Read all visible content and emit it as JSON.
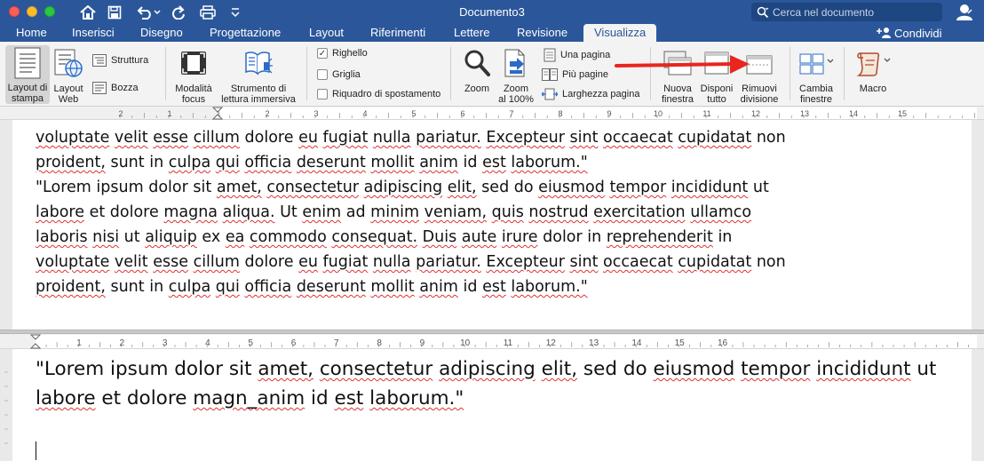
{
  "window": {
    "title": "Documento3",
    "search_placeholder": "Cerca nel documento",
    "share_label": "Condividi"
  },
  "tabs": [
    "Home",
    "Inserisci",
    "Disegno",
    "Progettazione",
    "Layout",
    "Riferimenti",
    "Lettere",
    "Revisione",
    "Visualizza"
  ],
  "active_tab": "Visualizza",
  "ribbon": {
    "layout_stampa": [
      "Layout di",
      "stampa"
    ],
    "layout_web": [
      "Layout",
      "Web"
    ],
    "struttura": "Struttura",
    "bozza": "Bozza",
    "modalita_focus": [
      "Modalità",
      "focus"
    ],
    "strumento_lettura": [
      "Strumento di",
      "lettura immersiva"
    ],
    "righello": "Righello",
    "griglia": "Griglia",
    "riquadro": "Riquadro di spostamento",
    "zoom": "Zoom",
    "zoom100": [
      "Zoom",
      "al 100%"
    ],
    "una_pagina": "Una pagina",
    "piu_pagine": "Più pagine",
    "larghezza_pagina": "Larghezza pagina",
    "nuova_finestra": [
      "Nuova",
      "finestra"
    ],
    "disponi_tutto": [
      "Disponi",
      "tutto"
    ],
    "rimuovi_divisione": [
      "Rimuovi",
      "divisione"
    ],
    "cambia_finestre": [
      "Cambia",
      "finestre"
    ],
    "macro": "Macro",
    "righello_checked": true,
    "griglia_checked": false,
    "riquadro_checked": false
  },
  "ruler_top_numbers": [
    "2",
    "1",
    "1",
    "2",
    "3",
    "4",
    "5",
    "6",
    "7",
    "8",
    "9",
    "10",
    "11",
    "12",
    "13",
    "14",
    "15"
  ],
  "ruler_bottom_numbers": [
    "1",
    "2",
    "3",
    "4",
    "5",
    "6",
    "7",
    "8",
    "9",
    "10",
    "11",
    "12",
    "13",
    "14",
    "15",
    "16"
  ],
  "top_pane_lines": [
    "voluptate velit esse cillum dolore eu fugiat nulla pariatur. Excepteur sint occaecat cupidatat non",
    "proident, sunt in culpa qui officia deserunt mollit anim id est laborum.\"",
    "\"Lorem ipsum dolor sit amet, consectetur adipiscing elit, sed do eiusmod tempor incididunt ut",
    "labore et dolore magna aliqua. Ut enim ad minim veniam, quis nostrud exercitation ullamco",
    "laboris nisi ut aliquip ex ea commodo consequat. Duis aute irure dolor in reprehenderit in",
    "voluptate velit esse cillum dolore eu fugiat nulla pariatur. Excepteur sint occaecat cupidatat non",
    "proident, sunt in culpa qui officia deserunt mollit anim id est laborum.\""
  ],
  "bottom_pane_lines": [
    "\"Lorem ipsum dolor sit amet, consectetur adipiscing elit, sed do eiusmod tempor incididunt ut",
    "labore et dolore magn_anim id est laborum.\""
  ],
  "colors": {
    "title_bar": "#2b579a",
    "ribbon_bg": "#f3f3f3",
    "annotation_arrow": "#e8261e"
  }
}
